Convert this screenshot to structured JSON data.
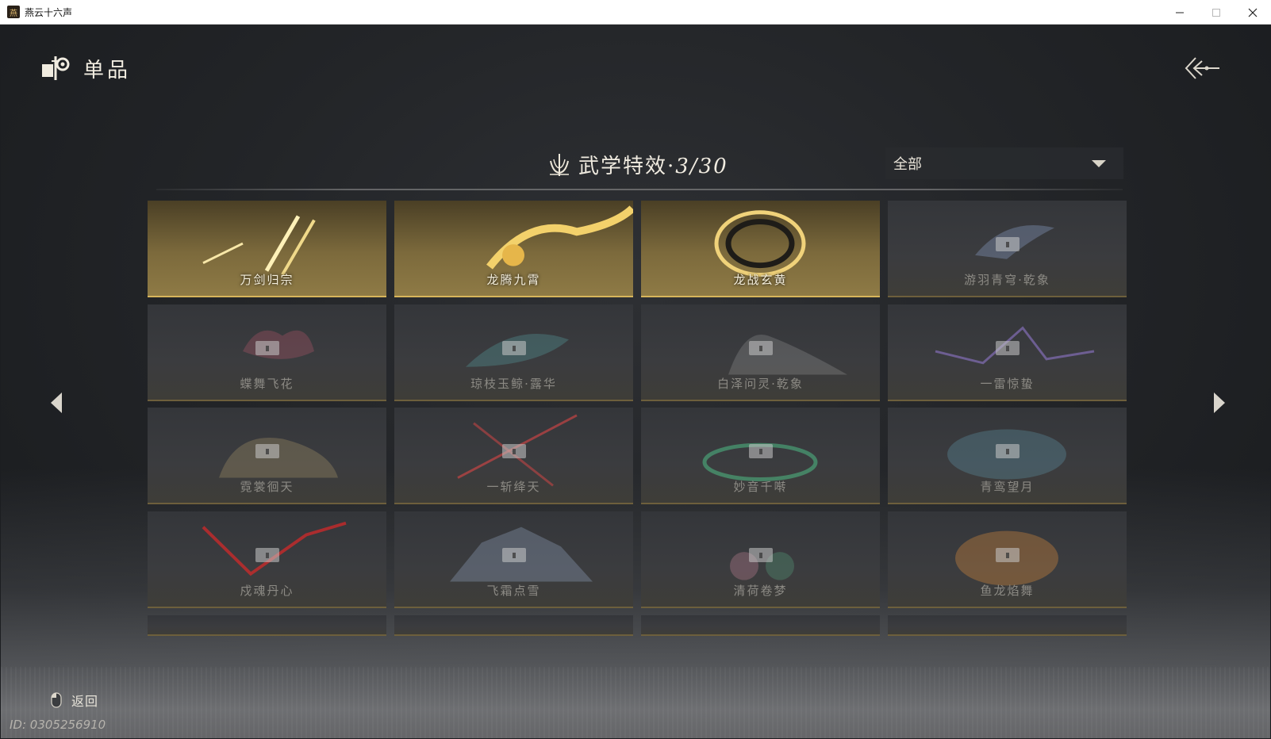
{
  "window": {
    "title": "燕云十六声",
    "icon": "game-logo-icon",
    "minimize_icon": "minimize-icon",
    "maximize_icon": "maximize-icon",
    "close_icon": "close-icon"
  },
  "header": {
    "title": "单品",
    "icon": "items-icon",
    "back_icon": "back-arrow-icon"
  },
  "section": {
    "title": "武学特效·",
    "count": "3/30",
    "icon": "lotus-blade-icon"
  },
  "filter": {
    "selected": "全部",
    "icon": "chevron-down-icon"
  },
  "cards": [
    {
      "label": "万剑归宗",
      "locked": false
    },
    {
      "label": "龙腾九霄",
      "locked": false
    },
    {
      "label": "龙战玄黄",
      "locked": false
    },
    {
      "label": "游羽青穹·乾象",
      "locked": true
    },
    {
      "label": "蝶舞飞花",
      "locked": true
    },
    {
      "label": "琼枝玉鲸·露华",
      "locked": true
    },
    {
      "label": "白泽问灵·乾象",
      "locked": true
    },
    {
      "label": "一雷惊蛰",
      "locked": true
    },
    {
      "label": "霓裳徊天",
      "locked": true
    },
    {
      "label": "一斩绛天",
      "locked": true
    },
    {
      "label": "妙音千啭",
      "locked": true
    },
    {
      "label": "青鸾望月",
      "locked": true
    },
    {
      "label": "戍魂丹心",
      "locked": true
    },
    {
      "label": "飞霜点雪",
      "locked": true
    },
    {
      "label": "清荷卷梦",
      "locked": true
    },
    {
      "label": "鱼龙焰舞",
      "locked": true
    }
  ],
  "nav": {
    "prev_icon": "arrow-left-icon",
    "next_icon": "arrow-right-icon"
  },
  "footer": {
    "back_label": "返回",
    "mouse_icon": "mouse-right-click-icon",
    "player_id": "ID: 0305256910"
  },
  "colors": {
    "gold": "#d7b55b",
    "background": "#232528",
    "text": "#e6e2d8"
  }
}
